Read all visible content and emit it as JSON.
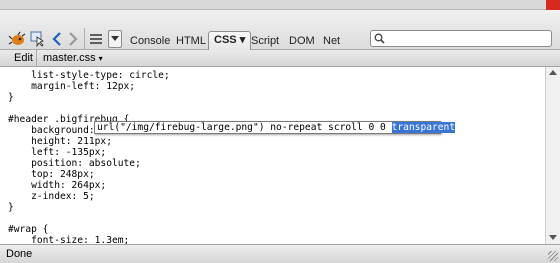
{
  "toolbar": {
    "tabs": [
      "Console",
      "HTML",
      "CSS",
      "Script",
      "DOM",
      "Net"
    ],
    "active_tab_suffix": "▾",
    "search_value": ""
  },
  "subbar": {
    "edit_label": "Edit",
    "file_label": "master.css",
    "file_caret": "▾"
  },
  "code_lines": [
    "    list-style-type: circle;",
    "    margin-left: 12px;",
    "}",
    "",
    "#header .bigfirebug {",
    "    background:",
    "    height: 211px;",
    "    left: -135px;",
    "    position: absolute;",
    "    top: 248px;",
    "    width: 264px;",
    "    z-index: 5;",
    "}",
    "",
    "#wrap {",
    "    font-size: 1.3em;"
  ],
  "inline_editor": {
    "value_text": "url(\"/img/firebug-large.png\") no-repeat scroll 0 0 ",
    "selected_text": "transparent"
  },
  "status": {
    "text": "Done"
  },
  "colors": {
    "selection": "#3875d7",
    "accent_red": "#d62a1e"
  }
}
